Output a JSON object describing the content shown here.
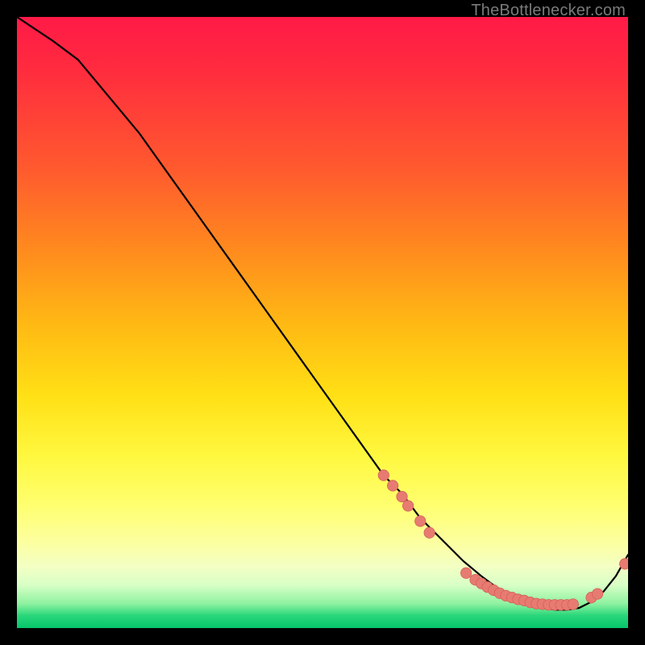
{
  "watermark": {
    "text": "TheBottlenecker.com"
  },
  "colors": {
    "curve_stroke": "#000000",
    "marker_fill": "#e77b72",
    "marker_stroke": "#d46258"
  },
  "chart_data": {
    "type": "line",
    "title": "",
    "xlabel": "",
    "ylabel": "",
    "xlim": [
      0,
      100
    ],
    "ylim": [
      0,
      100
    ],
    "grid": false,
    "series": [
      {
        "name": "bottleneck-curve",
        "x": [
          0,
          3,
          6,
          10,
          15,
          20,
          25,
          30,
          35,
          40,
          45,
          50,
          55,
          60,
          63,
          66,
          70,
          73,
          76,
          78,
          80,
          82,
          84,
          86,
          88,
          90,
          92,
          94,
          96,
          98,
          100
        ],
        "values": [
          100,
          98,
          96,
          93,
          87,
          81,
          74,
          67,
          60,
          53,
          46,
          39,
          32,
          25,
          22,
          18,
          14,
          11,
          8.5,
          7,
          5.8,
          4.8,
          4.0,
          3.4,
          3.0,
          3.0,
          3.3,
          4.3,
          6.0,
          8.5,
          12
        ]
      }
    ],
    "markers": [
      {
        "x": 60.0,
        "y": 25.0
      },
      {
        "x": 61.5,
        "y": 23.3
      },
      {
        "x": 63.0,
        "y": 21.5
      },
      {
        "x": 64.0,
        "y": 20.0
      },
      {
        "x": 66.0,
        "y": 17.5
      },
      {
        "x": 67.5,
        "y": 15.6
      },
      {
        "x": 73.5,
        "y": 9.0
      },
      {
        "x": 75.0,
        "y": 7.9
      },
      {
        "x": 76.0,
        "y": 7.3
      },
      {
        "x": 77.0,
        "y": 6.7
      },
      {
        "x": 78.0,
        "y": 6.2
      },
      {
        "x": 79.0,
        "y": 5.7
      },
      {
        "x": 80.0,
        "y": 5.3
      },
      {
        "x": 81.0,
        "y": 5.0
      },
      {
        "x": 82.0,
        "y": 4.7
      },
      {
        "x": 83.0,
        "y": 4.5
      },
      {
        "x": 84.0,
        "y": 4.2
      },
      {
        "x": 85.0,
        "y": 4.0
      },
      {
        "x": 86.0,
        "y": 3.9
      },
      {
        "x": 87.0,
        "y": 3.8
      },
      {
        "x": 88.0,
        "y": 3.8
      },
      {
        "x": 89.0,
        "y": 3.8
      },
      {
        "x": 90.0,
        "y": 3.8
      },
      {
        "x": 91.0,
        "y": 3.9
      },
      {
        "x": 94.0,
        "y": 5.0
      },
      {
        "x": 95.0,
        "y": 5.6
      },
      {
        "x": 99.5,
        "y": 10.5
      }
    ]
  }
}
